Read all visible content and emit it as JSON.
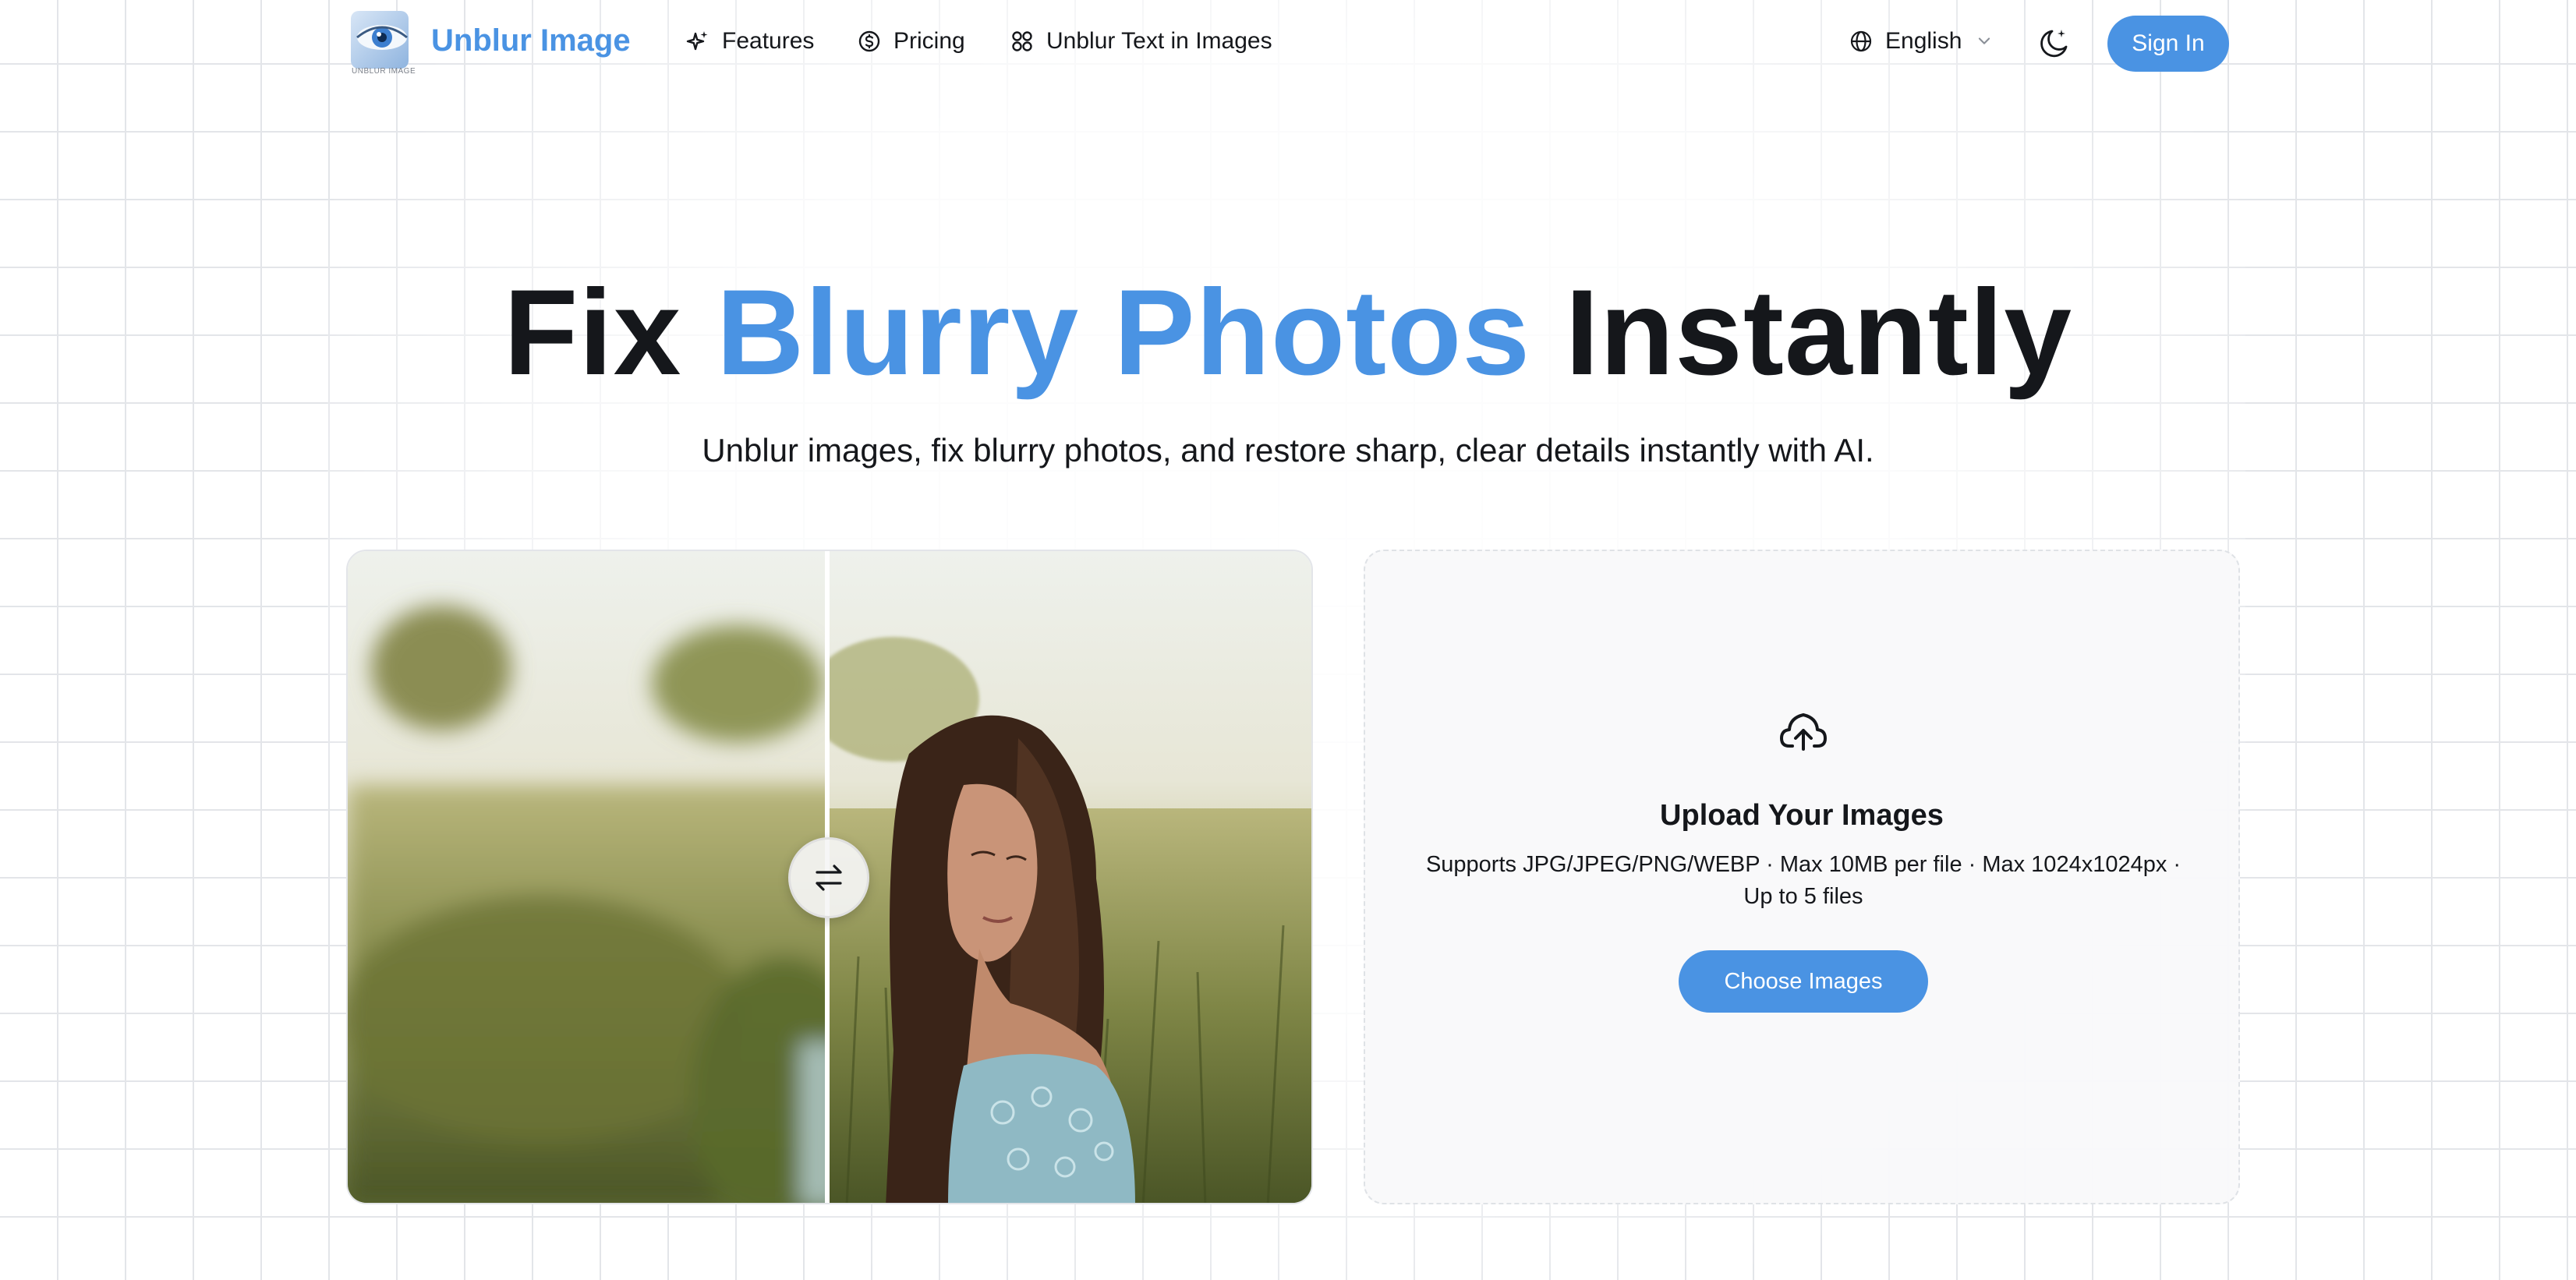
{
  "nav": {
    "logo_caption": "UNBLUR IMAGE",
    "brand": "Unblur Image",
    "links": [
      {
        "label": "Features",
        "icon": "sparkles-icon"
      },
      {
        "label": "Pricing",
        "icon": "dollar-circle-icon"
      },
      {
        "label": "Unblur Text in Images",
        "icon": "grid-icon"
      }
    ],
    "language": "English",
    "theme_icon": "moon-stars-icon",
    "signin": "Sign In"
  },
  "hero": {
    "title_part1": "Fix ",
    "title_highlight": "Blurry Photos",
    "title_part2": " Instantly",
    "subtitle": "Unblur images, fix blurry photos, and restore sharp, clear details instantly with AI."
  },
  "compare": {
    "handle_icon": "swap-arrows-icon"
  },
  "upload": {
    "icon": "cloud-upload-icon",
    "title": "Upload Your Images",
    "info": "Supports JPG/JPEG/PNG/WEBP · Max 10MB per file · Max 1024x1024px · Up to 5 files",
    "button": "Choose Images"
  },
  "colors": {
    "accent": "#4a93e3",
    "text": "#15171b",
    "grid": "#e3e5e9"
  }
}
